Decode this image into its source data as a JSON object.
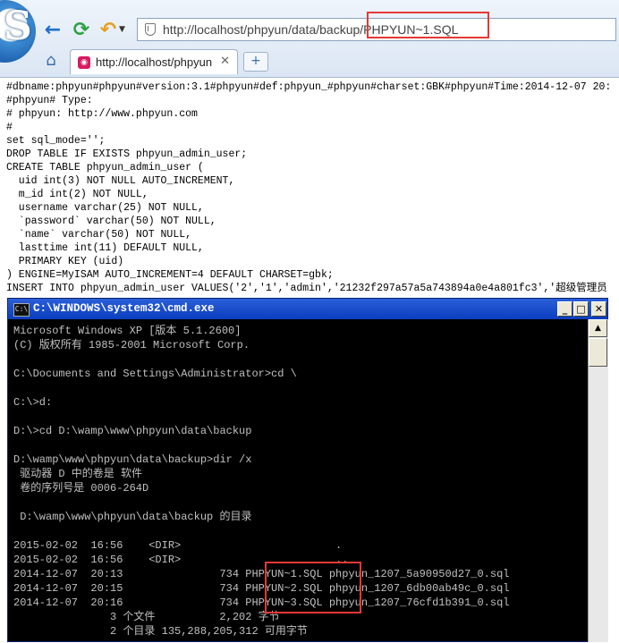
{
  "browser": {
    "address_url": "http://localhost/phpyun/data/backup/PHPYUN~1.SQL",
    "tab_title": "http://localhost/phpyun",
    "tab_close": "✕",
    "new_tab": "+",
    "logo_letter": "S",
    "icons": [
      "back-arrow-icon",
      "refresh-icon",
      "undo-icon",
      "shield-icon",
      "home-icon",
      "tab-favicon"
    ]
  },
  "sql_lines": [
    "#dbname:phpyun#phpyun#version:3.1#phpyun#def:phpyun_#phpyun#charset:GBK#phpyun#Time:2014-12-07 20:",
    "#phpyun# Type:",
    "# phpyun: http://www.phpyun.com",
    "#",
    "set sql_mode='';",
    "DROP TABLE IF EXISTS phpyun_admin_user;",
    "CREATE TABLE phpyun_admin_user (",
    "  uid int(3) NOT NULL AUTO_INCREMENT,",
    "  m_id int(2) NOT NULL,",
    "  username varchar(25) NOT NULL,",
    "  `password` varchar(50) NOT NULL,",
    "  `name` varchar(50) NOT NULL,",
    "  lasttime int(11) DEFAULT NULL,",
    "  PRIMARY KEY (uid)",
    ") ENGINE=MyISAM AUTO_INCREMENT=4 DEFAULT CHARSET=gbk;",
    "INSERT INTO phpyun_admin_user VALUES('2','1','admin','21232f297a57a5a743894a0e4a801fc3','超级管理员"
  ],
  "cmd": {
    "title": "C:\\WINDOWS\\system32\\cmd.exe",
    "lines": [
      "Microsoft Windows XP [版本 5.1.2600]",
      "(C) 版权所有 1985-2001 Microsoft Corp.",
      "",
      "C:\\Documents and Settings\\Administrator>cd \\",
      "",
      "C:\\>d:",
      "",
      "D:\\>cd D:\\wamp\\www\\phpyun\\data\\backup",
      "",
      "D:\\wamp\\www\\phpyun\\data\\backup>dir /x",
      " 驱动器 D 中的卷是 软件",
      " 卷的序列号是 0006-264D",
      "",
      " D:\\wamp\\www\\phpyun\\data\\backup 的目录",
      "",
      "2015-02-02  16:56    <DIR>                        .",
      "2015-02-02  16:56    <DIR>                        ..",
      "2014-12-07  20:13               734 PHPYUN~1.SQL phpyun_1207_5a90950d27_0.sql",
      "2014-12-07  20:15               734 PHPYUN~2.SQL phpyun_1207_6db00ab49c_0.sql",
      "2014-12-07  20:16               734 PHPYUN~3.SQL phpyun_1207_76cfd1b391_0.sql",
      "               3 个文件          2,202 字节",
      "               2 个目录 135,288,205,312 可用字节"
    ]
  }
}
